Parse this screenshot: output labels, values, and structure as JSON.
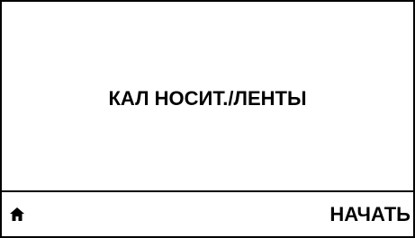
{
  "screen": {
    "title": "КАЛ НОСИТ./ЛЕНТЫ"
  },
  "softkeys": {
    "left_icon": "home-icon",
    "right_label": "НАЧАТЬ"
  },
  "colors": {
    "foreground": "#000000",
    "background": "#ffffff"
  }
}
